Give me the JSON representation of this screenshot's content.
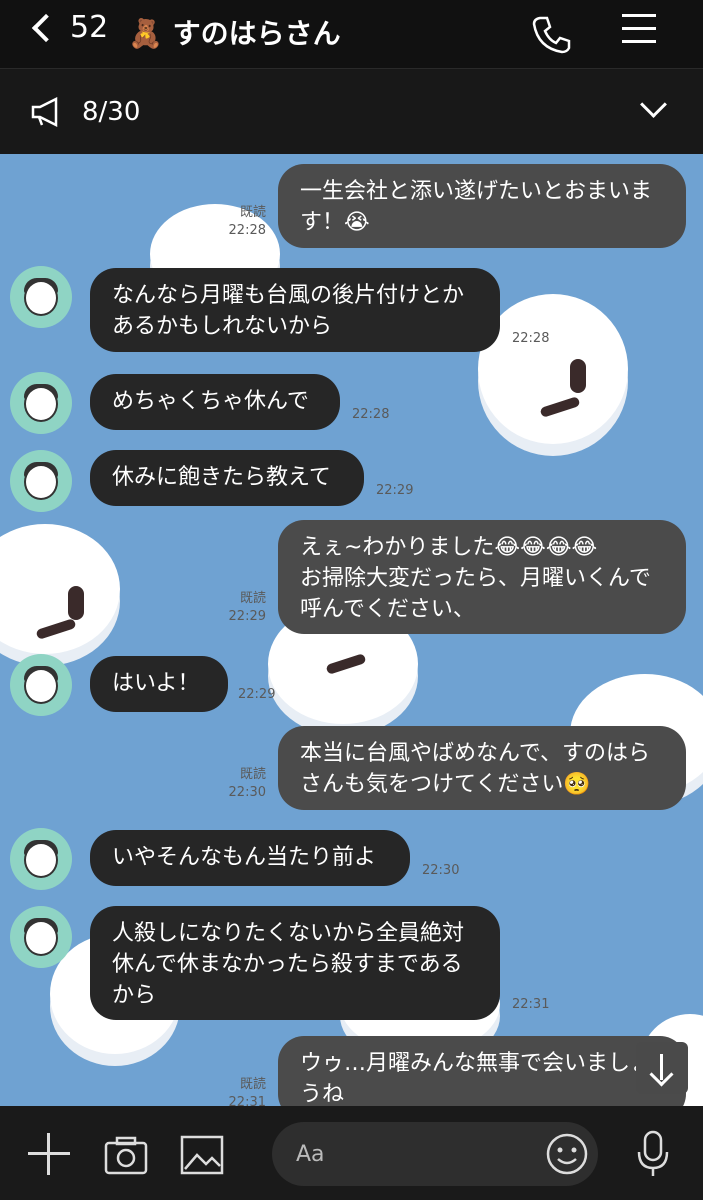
{
  "header": {
    "back_count": "52",
    "bear_icon": "🧸",
    "contact_name": "すのはらさん"
  },
  "notice": {
    "count": "8/30"
  },
  "messages": [
    {
      "side": "out",
      "text": "一生会社と添い遂げたいとおまいま\nす！😭",
      "read": "既読",
      "time": "22:28"
    },
    {
      "side": "in",
      "text": "なんなら月曜も台風の後片付けとか\nあるかもしれないから",
      "time": "22:28"
    },
    {
      "side": "in",
      "text": "めちゃくちゃ休んで",
      "time": "22:28"
    },
    {
      "side": "in",
      "text": "休みに飽きたら教えて",
      "time": "22:29"
    },
    {
      "side": "out",
      "text": "えぇ~わかりました😂😂😂😂\nお掃除大変だったら、月曜いくんで\n呼んでください、",
      "read": "既読",
      "time": "22:29"
    },
    {
      "side": "in",
      "text": "はいよ！",
      "time": "22:29"
    },
    {
      "side": "out",
      "text": "本当に台風やばめなんで、すのはら\nさんも気をつけてください🥺",
      "read": "既読",
      "time": "22:30"
    },
    {
      "side": "in",
      "text": "いやそんなもん当たり前よ",
      "time": "22:30"
    },
    {
      "side": "in",
      "text": "人殺しになりたくないから全員絶対\n休んで休まなかったら殺すまである\nから",
      "time": "22:31"
    },
    {
      "side": "out",
      "text": "ウゥ…月曜みんな無事で会いましょ\nうね",
      "read": "既読",
      "time": "22:31"
    }
  ],
  "composer": {
    "placeholder": "Aa"
  },
  "icons": [
    "chevron-left-icon",
    "bear-icon",
    "phone-icon",
    "menu-icon",
    "megaphone-icon",
    "chevron-down-icon",
    "scroll-down-icon",
    "plus-icon",
    "camera-icon",
    "image-icon",
    "emoji-icon",
    "mic-icon"
  ]
}
